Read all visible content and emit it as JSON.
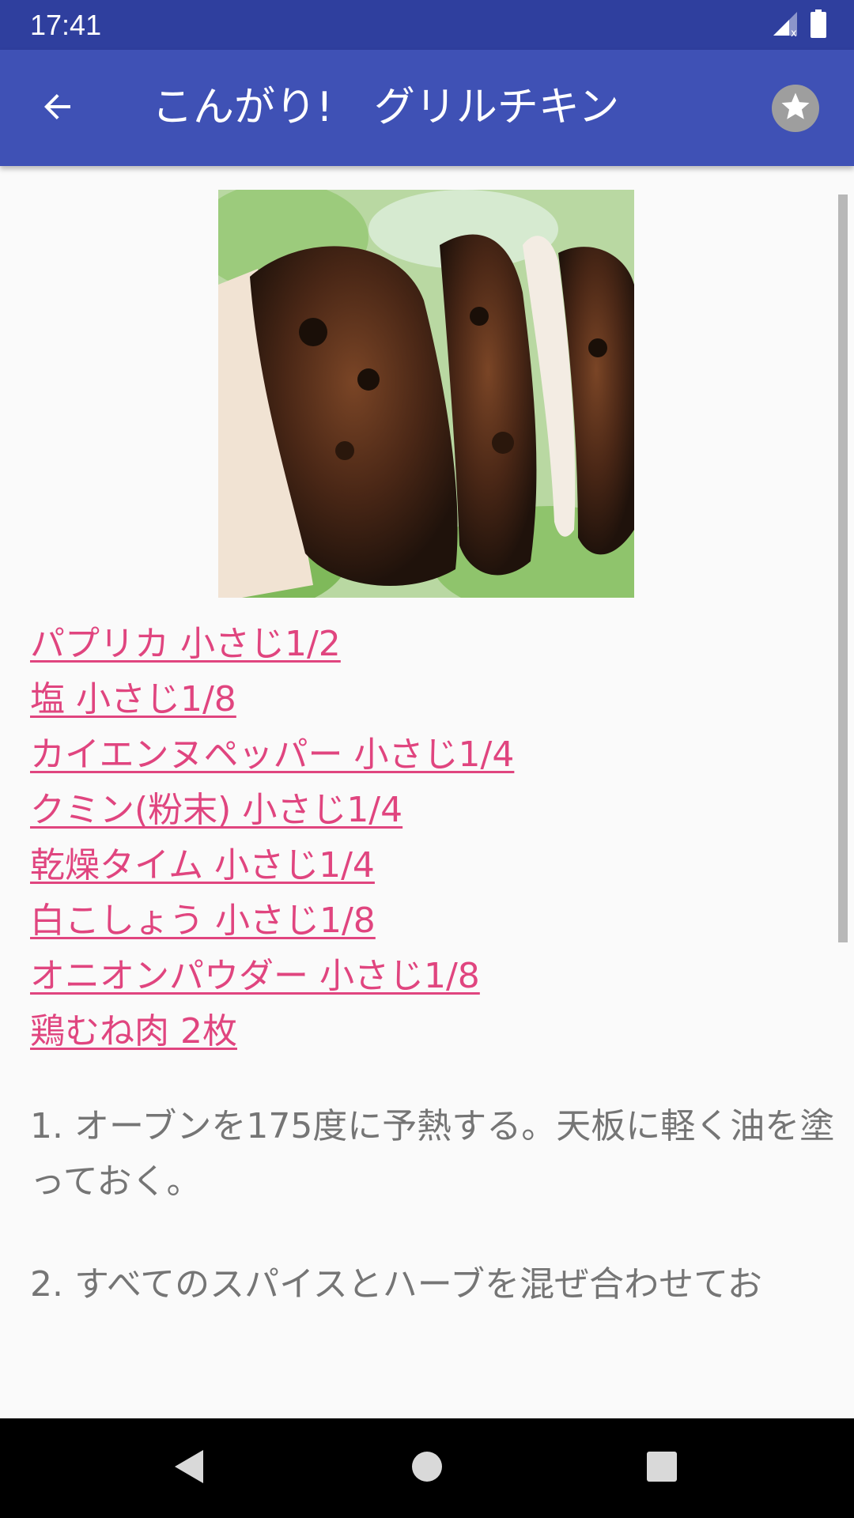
{
  "status_bar": {
    "time": "17:41",
    "icons": [
      "signal-no-sim-icon",
      "battery-icon"
    ]
  },
  "app_bar": {
    "title": "こんがり!　グリルチキン",
    "back_icon": "arrow-back-icon",
    "favorite_icon": "star-icon"
  },
  "recipe": {
    "ingredients": [
      "パプリカ 小さじ1/2",
      "塩 小さじ1/8",
      "カイエンヌペッパー 小さじ1/4",
      "クミン(粉末) 小さじ1/4",
      "乾燥タイム 小さじ1/4",
      "白こしょう 小さじ1/8",
      "オニオンパウダー 小さじ1/8",
      "鶏むね肉 2枚"
    ],
    "steps": [
      "1. オーブンを175度に予熱する。天板に軽く油を塗っておく。",
      "2. すべてのスパイスとハーブを混ぜ合わせてお"
    ]
  },
  "colors": {
    "status_bar": "#2f3f9e",
    "app_bar": "#3f51b5",
    "link": "#e0457f",
    "body_text": "#757575"
  },
  "nav_bar": {
    "icons": [
      "back-triangle-icon",
      "home-circle-icon",
      "recents-square-icon"
    ]
  }
}
